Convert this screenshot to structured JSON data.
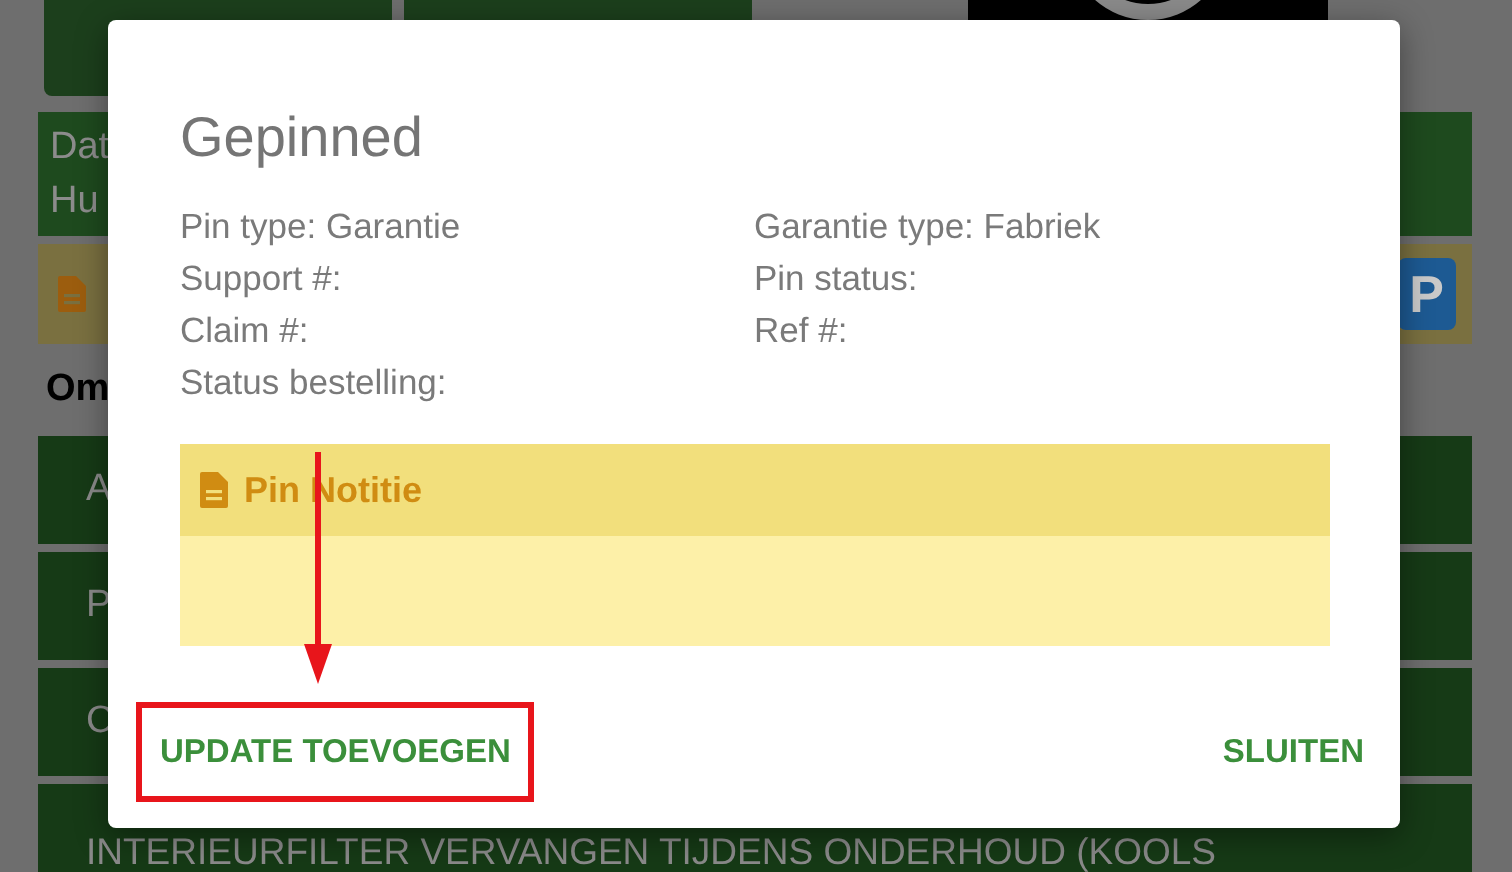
{
  "background": {
    "info_lines": [
      "Dat",
      "Hu"
    ],
    "badge": "P",
    "section_title": "Om",
    "rows": [
      "A",
      "P",
      "C",
      "INTERIEURFILTER VERVANGEN TIJDENS ONDERHOUD (KOOLS"
    ]
  },
  "dialog": {
    "title": "Gepinned",
    "fields": [
      "Pin type: Garantie",
      "Garantie type: Fabriek",
      "Support #:",
      "Pin status:",
      "Claim #:",
      "Ref #:",
      "Status bestelling:"
    ],
    "note": {
      "title": "Pin Notitie"
    },
    "buttons": [
      {
        "label": "UPDATE TOEVOEGEN",
        "highlighted": true
      },
      {
        "label": "SLUITEN",
        "highlighted": false
      }
    ]
  }
}
